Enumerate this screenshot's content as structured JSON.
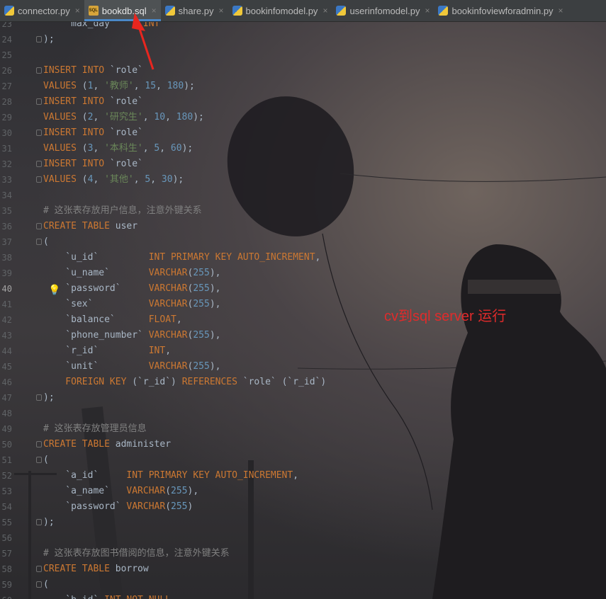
{
  "tabs": [
    {
      "label": "connector.py",
      "icon": "python-file-icon",
      "active": false
    },
    {
      "label": "bookdb.sql",
      "icon": "sql-file-icon",
      "active": true
    },
    {
      "label": "share.py",
      "icon": "python-file-icon",
      "active": false
    },
    {
      "label": "bookinfomodel.py",
      "icon": "python-file-icon",
      "active": false
    },
    {
      "label": "userinfomodel.py",
      "icon": "python-file-icon",
      "active": false
    },
    {
      "label": "bookinfoviewforadmin.py",
      "icon": "python-file-icon",
      "active": false
    }
  ],
  "close_glyph": "×",
  "lines": [
    {
      "n": "23",
      "segs": [
        [
          "id",
          "     max_day      "
        ],
        [
          "kw",
          "INT"
        ]
      ]
    },
    {
      "n": "24",
      "segs": [
        [
          "id",
          ");"
        ]
      ]
    },
    {
      "n": "25",
      "segs": []
    },
    {
      "n": "26",
      "segs": [
        [
          "kw",
          "INSERT INTO "
        ],
        [
          "id",
          "`role`"
        ]
      ]
    },
    {
      "n": "27",
      "segs": [
        [
          "kw",
          "VALUES "
        ],
        [
          "id",
          "("
        ],
        [
          "num",
          "1"
        ],
        [
          "id",
          ", "
        ],
        [
          "str",
          "'教师'"
        ],
        [
          "id",
          ", "
        ],
        [
          "num",
          "15"
        ],
        [
          "id",
          ", "
        ],
        [
          "num",
          "180"
        ],
        [
          "id",
          ");"
        ]
      ]
    },
    {
      "n": "28",
      "segs": [
        [
          "kw",
          "INSERT INTO "
        ],
        [
          "id",
          "`role`"
        ]
      ]
    },
    {
      "n": "29",
      "segs": [
        [
          "kw",
          "VALUES "
        ],
        [
          "id",
          "("
        ],
        [
          "num",
          "2"
        ],
        [
          "id",
          ", "
        ],
        [
          "str",
          "'研究生'"
        ],
        [
          "id",
          ", "
        ],
        [
          "num",
          "10"
        ],
        [
          "id",
          ", "
        ],
        [
          "num",
          "180"
        ],
        [
          "id",
          ");"
        ]
      ]
    },
    {
      "n": "30",
      "segs": [
        [
          "kw",
          "INSERT INTO "
        ],
        [
          "id",
          "`role`"
        ]
      ]
    },
    {
      "n": "31",
      "segs": [
        [
          "kw",
          "VALUES "
        ],
        [
          "id",
          "("
        ],
        [
          "num",
          "3"
        ],
        [
          "id",
          ", "
        ],
        [
          "str",
          "'本科生'"
        ],
        [
          "id",
          ", "
        ],
        [
          "num",
          "5"
        ],
        [
          "id",
          ", "
        ],
        [
          "num",
          "60"
        ],
        [
          "id",
          ");"
        ]
      ]
    },
    {
      "n": "32",
      "segs": [
        [
          "kw",
          "INSERT INTO "
        ],
        [
          "id",
          "`role`"
        ]
      ]
    },
    {
      "n": "33",
      "segs": [
        [
          "kw",
          "VALUES "
        ],
        [
          "id",
          "("
        ],
        [
          "num",
          "4"
        ],
        [
          "id",
          ", "
        ],
        [
          "str",
          "'其他'"
        ],
        [
          "id",
          ", "
        ],
        [
          "num",
          "5"
        ],
        [
          "id",
          ", "
        ],
        [
          "num",
          "30"
        ],
        [
          "id",
          ");"
        ]
      ]
    },
    {
      "n": "34",
      "segs": []
    },
    {
      "n": "35",
      "segs": [
        [
          "cmt",
          "# 这张表存放用户信息，注意外键关系"
        ]
      ]
    },
    {
      "n": "36",
      "segs": [
        [
          "kw",
          "CREATE TABLE "
        ],
        [
          "id",
          "user"
        ]
      ]
    },
    {
      "n": "37",
      "segs": [
        [
          "id",
          "("
        ]
      ]
    },
    {
      "n": "38",
      "segs": [
        [
          "id",
          "    `u_id`         "
        ],
        [
          "kw",
          "INT PRIMARY KEY AUTO_INCREMENT"
        ],
        [
          "id",
          ","
        ]
      ]
    },
    {
      "n": "39",
      "segs": [
        [
          "id",
          "    `u_name`       "
        ],
        [
          "kw",
          "VARCHAR"
        ],
        [
          "id",
          "("
        ],
        [
          "num",
          "255"
        ],
        [
          "id",
          "),"
        ]
      ]
    },
    {
      "n": "40",
      "segs": [
        [
          "id",
          "    `password`     "
        ],
        [
          "kw",
          "VARCHAR"
        ],
        [
          "id",
          "("
        ],
        [
          "num",
          "255"
        ],
        [
          "id",
          "),"
        ]
      ]
    },
    {
      "n": "41",
      "segs": [
        [
          "id",
          "    `sex`          "
        ],
        [
          "kw",
          "VARCHAR"
        ],
        [
          "id",
          "("
        ],
        [
          "num",
          "255"
        ],
        [
          "id",
          "),"
        ]
      ]
    },
    {
      "n": "42",
      "segs": [
        [
          "id",
          "    `balance`      "
        ],
        [
          "kw",
          "FLOAT"
        ],
        [
          "id",
          ","
        ]
      ]
    },
    {
      "n": "43",
      "segs": [
        [
          "id",
          "    `phone_number` "
        ],
        [
          "kw",
          "VARCHAR"
        ],
        [
          "id",
          "("
        ],
        [
          "num",
          "255"
        ],
        [
          "id",
          "),"
        ]
      ]
    },
    {
      "n": "44",
      "segs": [
        [
          "id",
          "    `r_id`         "
        ],
        [
          "kw",
          "INT"
        ],
        [
          "id",
          ","
        ]
      ]
    },
    {
      "n": "45",
      "segs": [
        [
          "id",
          "    `unit`         "
        ],
        [
          "kw",
          "VARCHAR"
        ],
        [
          "id",
          "("
        ],
        [
          "num",
          "255"
        ],
        [
          "id",
          "),"
        ]
      ]
    },
    {
      "n": "46",
      "segs": [
        [
          "kw",
          "    FOREIGN KEY "
        ],
        [
          "id",
          "(`r_id`) "
        ],
        [
          "kw",
          "REFERENCES "
        ],
        [
          "id",
          "`role` (`r_id`)"
        ]
      ]
    },
    {
      "n": "47",
      "segs": [
        [
          "id",
          ");"
        ]
      ]
    },
    {
      "n": "48",
      "segs": []
    },
    {
      "n": "49",
      "segs": [
        [
          "cmt",
          "# 这张表存放管理员信息"
        ]
      ]
    },
    {
      "n": "50",
      "segs": [
        [
          "kw",
          "CREATE TABLE "
        ],
        [
          "id",
          "administer"
        ]
      ]
    },
    {
      "n": "51",
      "segs": [
        [
          "id",
          "("
        ]
      ]
    },
    {
      "n": "52",
      "segs": [
        [
          "id",
          "    `a_id`     "
        ],
        [
          "kw",
          "INT PRIMARY KEY AUTO_INCREMENT"
        ],
        [
          "id",
          ","
        ]
      ]
    },
    {
      "n": "53",
      "segs": [
        [
          "id",
          "    `a_name`   "
        ],
        [
          "kw",
          "VARCHAR"
        ],
        [
          "id",
          "("
        ],
        [
          "num",
          "255"
        ],
        [
          "id",
          "),"
        ]
      ]
    },
    {
      "n": "54",
      "segs": [
        [
          "id",
          "    `password` "
        ],
        [
          "kw",
          "VARCHAR"
        ],
        [
          "id",
          "("
        ],
        [
          "num",
          "255"
        ],
        [
          "id",
          ")"
        ]
      ]
    },
    {
      "n": "55",
      "segs": [
        [
          "id",
          ");"
        ]
      ]
    },
    {
      "n": "56",
      "segs": []
    },
    {
      "n": "57",
      "segs": [
        [
          "cmt",
          "# 这张表存放图书借阅的信息，注意外键关系"
        ]
      ]
    },
    {
      "n": "58",
      "segs": [
        [
          "kw",
          "CREATE TABLE "
        ],
        [
          "id",
          "borrow"
        ]
      ]
    },
    {
      "n": "59",
      "segs": [
        [
          "id",
          "("
        ]
      ]
    },
    {
      "n": "60",
      "segs": [
        [
          "id",
          "    `b_id` "
        ],
        [
          "kw",
          "INT NOT NULL"
        ]
      ]
    }
  ],
  "current_line": "40",
  "annotation": "cv到sql server 运行",
  "colors": {
    "annotation": "#e02b2b",
    "keyword": "#cc7832",
    "string": "#6a8759",
    "number": "#6897bb",
    "comment": "#808080",
    "tab_underline": "#4a88c7"
  }
}
